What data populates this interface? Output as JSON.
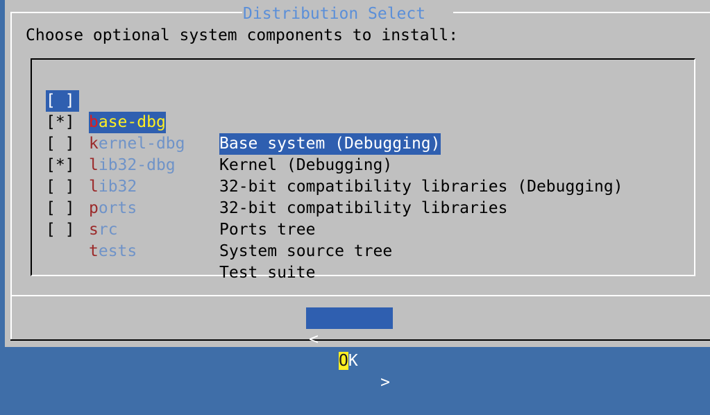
{
  "dialog": {
    "title": "Distribution Select",
    "prompt": "Choose optional system components to install:"
  },
  "items": [
    {
      "checkbox": "[ ]",
      "hotkey": "b",
      "rest": "ase-dbg",
      "description": "Base system (Debugging)",
      "checked": false,
      "selected": true
    },
    {
      "checkbox": "[*]",
      "hotkey": "k",
      "rest": "ernel-dbg",
      "description": "Kernel (Debugging)",
      "checked": true,
      "selected": false
    },
    {
      "checkbox": "[ ]",
      "hotkey": "l",
      "rest": "ib32-dbg",
      "description": "32-bit compatibility libraries (Debugging)",
      "checked": false,
      "selected": false
    },
    {
      "checkbox": "[*]",
      "hotkey": "l",
      "rest": "ib32",
      "description": "32-bit compatibility libraries",
      "checked": true,
      "selected": false
    },
    {
      "checkbox": "[ ]",
      "hotkey": "p",
      "rest": "orts",
      "description": "Ports tree",
      "checked": false,
      "selected": false
    },
    {
      "checkbox": "[ ]",
      "hotkey": "s",
      "rest": "rc",
      "description": "System source tree",
      "checked": false,
      "selected": false
    },
    {
      "checkbox": "[ ]",
      "hotkey": "t",
      "rest": "ests",
      "description": "Test suite",
      "checked": false,
      "selected": false
    }
  ],
  "buttons": {
    "ok": {
      "left": "<",
      "hotkey": "O",
      "rest": "K",
      "right": ">"
    }
  },
  "colors": {
    "screen_background": "#3f6ea8",
    "dialog_background": "#c0c0c0",
    "selection": "#2f5fb0",
    "title_text": "#5b8fd8",
    "item_name": "#6f93c8",
    "hotkey": "#9b2a2a",
    "highlight_yellow": "#ffef22"
  }
}
